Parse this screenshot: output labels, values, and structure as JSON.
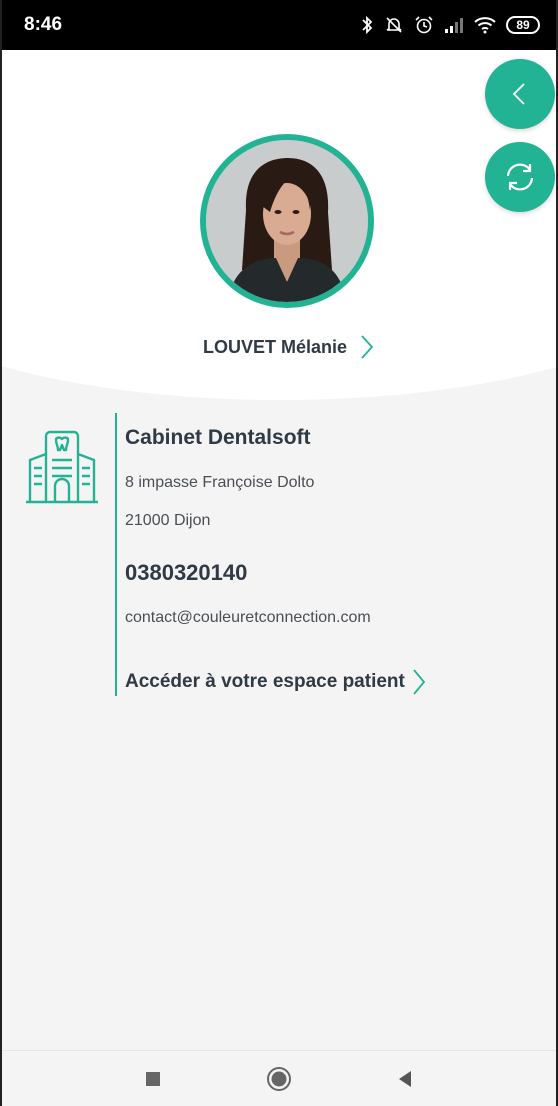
{
  "status_bar": {
    "time": "8:46",
    "battery": "89",
    "icons": [
      "bluetooth-icon",
      "mute-notifications-icon",
      "alarm-icon",
      "signal-icon",
      "wifi-icon",
      "battery-icon"
    ]
  },
  "header": {
    "patient_name": "LOUVET Mélanie",
    "back_icon": "chevron-left-icon",
    "refresh_icon": "refresh-icon"
  },
  "cabinet": {
    "name": "Cabinet Dentalsoft",
    "address_line1": "8 impasse Françoise Dolto",
    "address_line2": "21000 Dijon",
    "phone": "0380320140",
    "email": "contact@couleuretconnection.com",
    "access_link": "Accéder à votre espace patient",
    "icon": "dental-building-icon"
  },
  "nav": {
    "icons": [
      "recent-apps-icon",
      "home-icon",
      "back-icon"
    ]
  },
  "colors": {
    "accent": "#22b395",
    "text": "#2f3a45",
    "background": "#f4f4f4"
  }
}
